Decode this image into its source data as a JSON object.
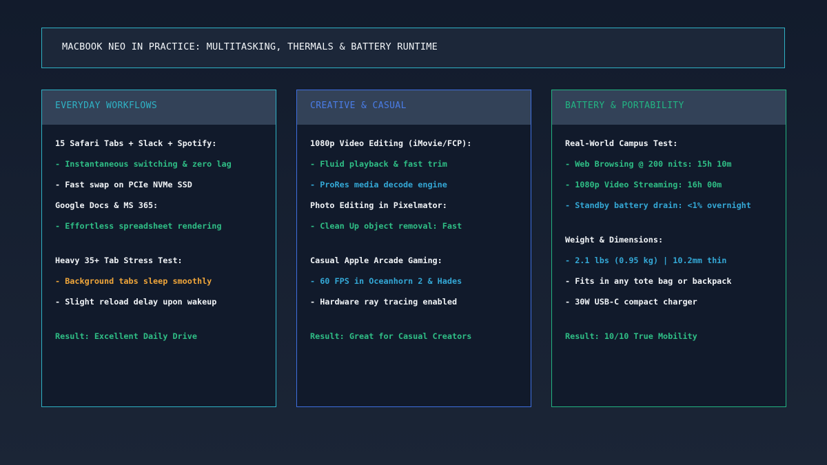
{
  "title": "MACBOOK NEO IN PRACTICE: MULTITASKING, THERMALS & BATTERY RUNTIME",
  "colors": {
    "title_border": "#2fb3c6",
    "card1_accent": "#2fb3c6",
    "card2_accent": "#3f6fe0",
    "card3_accent": "#22b583",
    "white": "#f1f4f7",
    "green": "#2fbf86",
    "blue": "#34a8d6",
    "orange": "#f0a63a"
  },
  "cards": [
    {
      "heading": "EVERYDAY WORKFLOWS",
      "lines": [
        {
          "text": "15 Safari Tabs + Slack + Spotify:",
          "color": "white"
        },
        {
          "text": "- Instantaneous switching & zero lag",
          "color": "green"
        },
        {
          "text": "- Fast swap on PCIe NVMe SSD",
          "color": "white"
        },
        {
          "text": "Google Docs & MS 365:",
          "color": "white"
        },
        {
          "text": "- Effortless spreadsheet rendering",
          "color": "green"
        },
        {
          "text": "",
          "color": "white"
        },
        {
          "text": "Heavy 35+ Tab Stress Test:",
          "color": "white"
        },
        {
          "text": "- Background tabs sleep smoothly",
          "color": "orange"
        },
        {
          "text": "- Slight reload delay upon wakeup",
          "color": "white"
        },
        {
          "text": "",
          "color": "white"
        },
        {
          "text": "Result: Excellent Daily Drive",
          "color": "green"
        }
      ]
    },
    {
      "heading": "CREATIVE & CASUAL",
      "lines": [
        {
          "text": "1080p Video Editing (iMovie/FCP):",
          "color": "white"
        },
        {
          "text": "- Fluid playback & fast trim",
          "color": "green"
        },
        {
          "text": "- ProRes media decode engine",
          "color": "blue"
        },
        {
          "text": "Photo Editing in Pixelmator:",
          "color": "white"
        },
        {
          "text": "- Clean Up object removal: Fast",
          "color": "green"
        },
        {
          "text": "",
          "color": "white"
        },
        {
          "text": "Casual Apple Arcade Gaming:",
          "color": "white"
        },
        {
          "text": "- 60 FPS in Oceanhorn 2 & Hades",
          "color": "blue"
        },
        {
          "text": "- Hardware ray tracing enabled",
          "color": "white"
        },
        {
          "text": "",
          "color": "white"
        },
        {
          "text": "Result: Great for Casual Creators",
          "color": "green"
        }
      ]
    },
    {
      "heading": "BATTERY & PORTABILITY",
      "lines": [
        {
          "text": "Real-World Campus Test:",
          "color": "white"
        },
        {
          "text": "- Web Browsing @ 200 nits: 15h 10m",
          "color": "green"
        },
        {
          "text": "- 1080p Video Streaming: 16h 00m",
          "color": "green"
        },
        {
          "text": "- Standby battery drain: <1% overnight",
          "color": "blue"
        },
        {
          "text": "",
          "color": "white"
        },
        {
          "text": "Weight & Dimensions:",
          "color": "white"
        },
        {
          "text": "- 2.1 lbs (0.95 kg) | 10.2mm thin",
          "color": "blue"
        },
        {
          "text": "- Fits in any tote bag or backpack",
          "color": "white"
        },
        {
          "text": "- 30W USB-C compact charger",
          "color": "white"
        },
        {
          "text": "",
          "color": "white"
        },
        {
          "text": "Result: 10/10 True Mobility",
          "color": "green"
        }
      ]
    }
  ]
}
